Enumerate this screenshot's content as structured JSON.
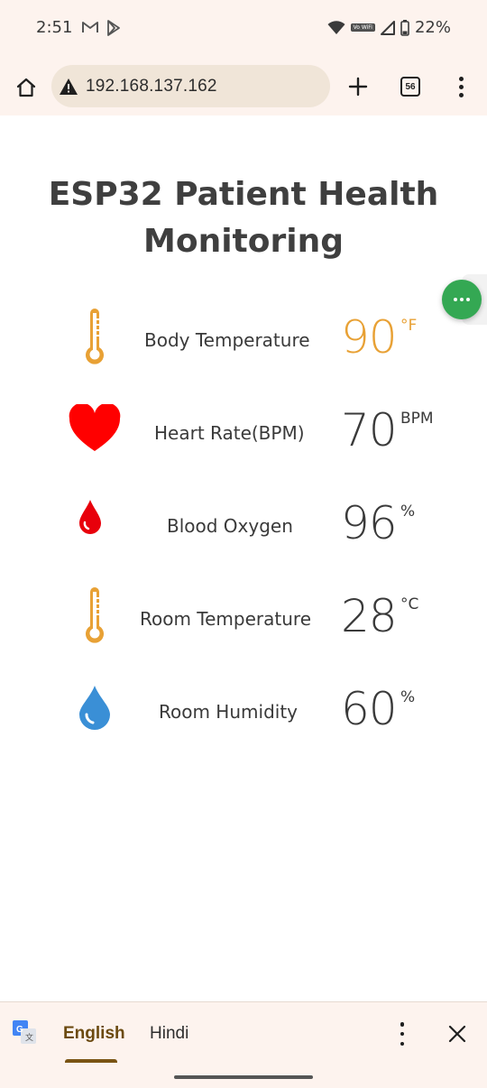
{
  "status_bar": {
    "time": "2:51",
    "left_icons": [
      "gmail-icon",
      "play-store-icon"
    ],
    "vowifi_label": "Vo WiFi",
    "battery": "22%"
  },
  "browser": {
    "url": "192.168.137.162",
    "tab_count": "56"
  },
  "page": {
    "title": "ESP32 Patient Health Monitoring",
    "readings": [
      {
        "label": "Body Temperature",
        "value": "90",
        "unit": "°F",
        "value_color": "#e8a135",
        "icon": "thermometer-icon"
      },
      {
        "label": "Heart Rate(BPM)",
        "value": "70",
        "unit": "BPM",
        "value_color": "#3a3a3a",
        "icon": "heart-icon"
      },
      {
        "label": "Blood Oxygen",
        "value": "96",
        "unit": "%",
        "value_color": "#3a3a3a",
        "icon": "blood-drop-icon"
      },
      {
        "label": "Room Temperature",
        "value": "28",
        "unit": "°C",
        "value_color": "#3a3a3a",
        "icon": "thermometer-icon"
      },
      {
        "label": "Room Humidity",
        "value": "60",
        "unit": "%",
        "value_color": "#3a3a3a",
        "icon": "water-drop-icon"
      }
    ]
  },
  "translate_bar": {
    "source_language": "English",
    "target_language": "Hindi"
  },
  "colors": {
    "chrome_background": "#fdf3ee",
    "urlbar_background": "#f0e5d8",
    "thermometer": "#e8a135",
    "heart": "#ff0000",
    "blood": "#e8000b",
    "humidity": "#3a8fd6",
    "assistant_bubble": "#34a853"
  }
}
